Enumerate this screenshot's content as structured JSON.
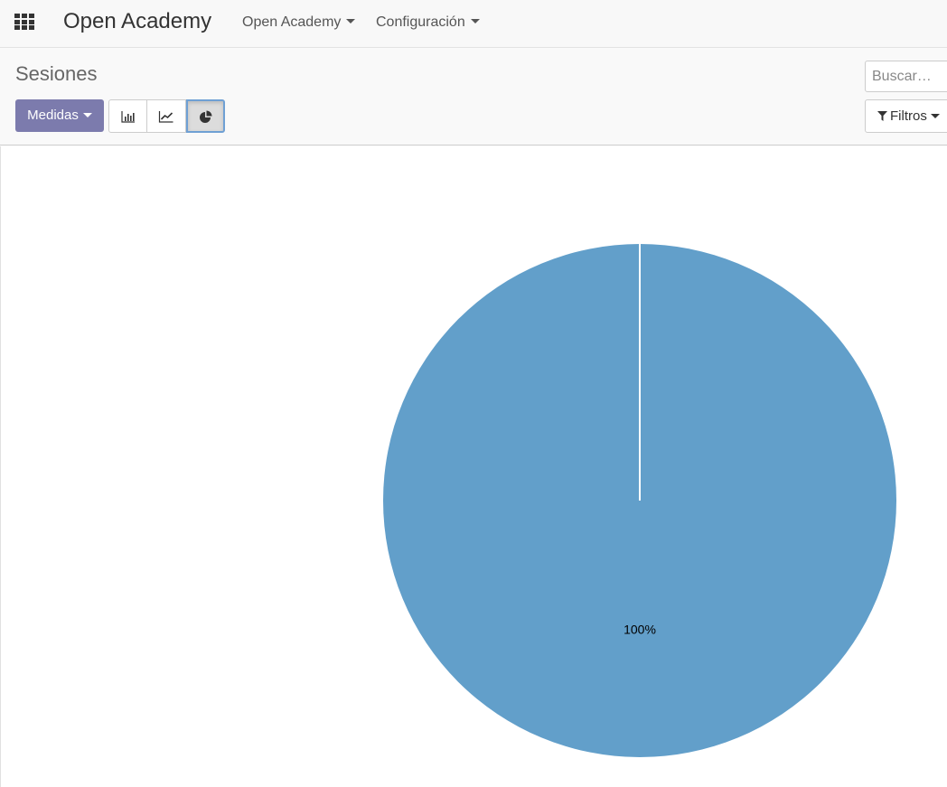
{
  "navbar": {
    "brand": "Open Academy",
    "menus": [
      {
        "label": "Open Academy"
      },
      {
        "label": "Configuración"
      }
    ]
  },
  "control_panel": {
    "breadcrumb": "Sesiones",
    "measures_label": "Medidas",
    "views": [
      {
        "name": "bar",
        "icon": "bar-chart-icon",
        "active": false
      },
      {
        "name": "line",
        "icon": "line-chart-icon",
        "active": false
      },
      {
        "name": "pie",
        "icon": "pie-chart-icon",
        "active": true
      }
    ],
    "search": {
      "placeholder": "Buscar…",
      "value": ""
    },
    "filters_label": "Filtros"
  },
  "colors": {
    "primary": "#7c7bad",
    "pie_slice": "#629fca"
  },
  "chart_data": {
    "type": "pie",
    "categories": [
      ""
    ],
    "values": [
      100
    ],
    "data_labels": [
      "100%"
    ],
    "title": "",
    "legend": "none"
  }
}
